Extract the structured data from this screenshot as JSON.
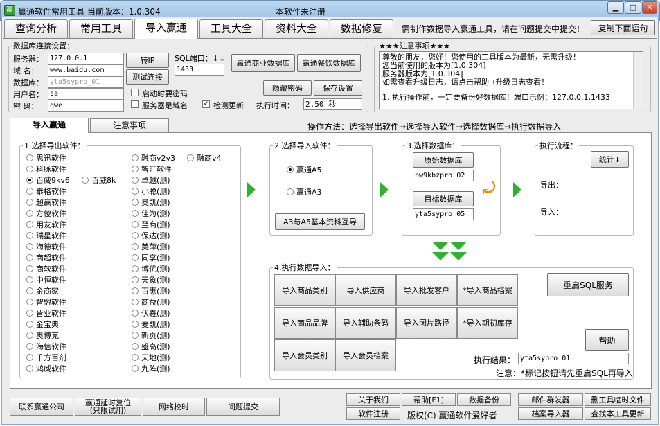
{
  "window": {
    "title": "赢通软件常用工具  当前版本：1.0.304",
    "center_text": "本软件未注册",
    "min": "▁",
    "max": "□",
    "close": "✕"
  },
  "main_tabs": [
    "查询分析",
    "常用工具",
    "导入赢通",
    "工具大全",
    "资料大全",
    "数据修复"
  ],
  "top_hint": "需制作数据导入赢通工具，请在问题提交中提交！",
  "copy_button": "复制下面语句",
  "db": {
    "legend": "数据库连接设置：",
    "server_label": "服务器：",
    "server": "127.0.0.1",
    "domain_label": "域    名：",
    "domain": "www.baidu.com",
    "database_label": "数据库：",
    "database": "yta5sypro_01",
    "user_label": "用户名：",
    "user": "sa",
    "password_label": "密    码：",
    "password": "qwe",
    "zhuan_ip": "转IP",
    "test_conn": "测试连接",
    "sql_port_label": "SQL端口：↓↓",
    "sql_port": "1433",
    "commerce_db": "赢通商业数据库",
    "catering_db": "赢通餐饮数据库",
    "hide_pw": "隐藏密码",
    "save_settings": "保存设置",
    "remember_pw": "启动时要密码",
    "server_is_domain": "服务器是域名",
    "check_update": "检测更新",
    "check_update_mark": "✓",
    "exec_time_label": "执行时间：",
    "exec_time": "2.50 秒"
  },
  "notices": {
    "title": "★★★注意事项★★★",
    "lines": [
      "尊敬的朋友，您好！您使用的工具版本为最新，无需升级！",
      "您当前使用的版本为[1.0.304]",
      "服务器版本为[1.0.304]",
      "如需查看升级日志，请点击帮助→升级日志查看！",
      "",
      "1. 执行操作前，一定要备份好数据库！端口示例：127.0.0.1,1433"
    ]
  },
  "sub_tabs": [
    "导入赢通",
    "注意事项"
  ],
  "operation_method": "操作方法：选择导出软件→选择导入软件→选择数据库→执行数据导入",
  "export_sw": {
    "legend": "1.选择导出软件：",
    "col1": [
      "思迅软件",
      "科脉软件",
      "百威9kv6",
      "泰格软件",
      "超赢软件",
      "方傻软件",
      "用友软件",
      "瑞星软件",
      "海德软件",
      "商超软件",
      "商软软件",
      "中恒软件",
      "金商家",
      "智盟软件",
      "晋业软件",
      "金宝典",
      "奥博克",
      "海信软件",
      "千方百剂",
      "鸿威软件"
    ],
    "extra": "百威8k",
    "col2": [
      "融商v2v3",
      "智汇软件",
      "卓越(测)",
      "小聪(测)",
      "奥凯(测)",
      "佳为(测)",
      "至商(测)",
      "保达(测)",
      "美萍(测)",
      "同享(测)",
      "博优(测)",
      "天象(测)",
      "百惠(测)",
      "商益(测)",
      "伏羲(测)",
      "麦凯(测)",
      "新页(测)",
      "盛高(测)",
      "天地(测)",
      "九阵(测)"
    ],
    "extra2": "融商v4"
  },
  "import_sw": {
    "legend": "2.选择导入软件：",
    "a5": "赢通A5",
    "a3": "赢通A3",
    "btn": "A3与A5基本资料互导"
  },
  "select_db": {
    "legend": "3.选择数据库：",
    "source_btn": "原始数据库",
    "source": "bw9kbzpro_02",
    "target_btn": "目标数据库",
    "target": "yta5sypro_05"
  },
  "flow": {
    "legend": "执行流程：",
    "stats": "统计↓",
    "export": "导出：",
    "import": "导入："
  },
  "exec": {
    "legend": "4.执行数据导入：",
    "buttons": [
      "导入商品类别",
      "导入供应商",
      "导入批发客户",
      "*导入商品档案",
      "导入商品品牌",
      "导入辅助条码",
      "导入图片路径",
      "*导入期初库存",
      "导入会员类别",
      "导入会员档案"
    ],
    "restart_sql": "重启SQL服务",
    "help": "帮助",
    "result_label": "执行结果：",
    "result": "yta5sypro_01",
    "note": "注意：*标记按钮请先重启SQL再导入"
  },
  "bottom": {
    "contact": "联系赢通公司",
    "delay_reset": "赢通延时复位\n(只限试用)",
    "net_time": "网络校时",
    "submit": "问题提交",
    "about": "关于我们",
    "help": "帮助[F1]",
    "backup": "数据备份",
    "register": "软件注册",
    "copyright": "版权(C) 赢通软件爱好者",
    "mail": "邮件群发器",
    "del_temp": "删工具临时文件",
    "archive": "档案导入器",
    "update": "查找本工具更新"
  }
}
